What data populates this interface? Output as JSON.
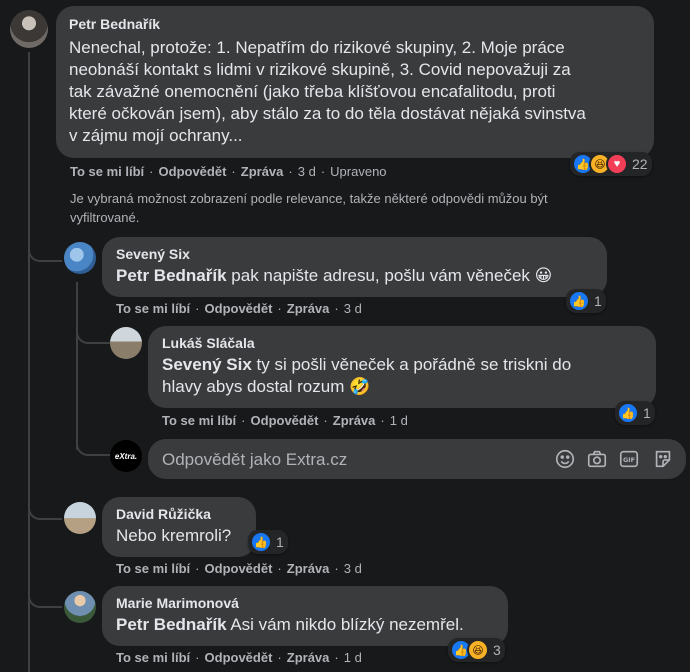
{
  "comments": {
    "main": {
      "author": "Petr Bednařík",
      "text_lines": [
        "Nenechal, protože: 1. Nepatřím do rizikové skupiny, 2. Moje práce",
        "neobnáší kontakt s lidmi v rizikové skupině, 3. Covid nepovažuji za",
        "tak závažné onemocnění (jako třeba klíšťovou encafalitodu, proti",
        "které očkován jsem), aby stálo za to do těla dostávat nějaká svinstva",
        "v zájmu mojí ochrany..."
      ],
      "like": "To se mi líbí",
      "reply": "Odpovědět",
      "message": "Zpráva",
      "time": "3 d",
      "edited": "Upraveno",
      "reaction_count": "22"
    },
    "relevance_notice_lines": [
      "Je vybraná možnost zobrazení podle relevance, takže některé odpovědi můžou být",
      "vyfiltrované."
    ],
    "reply1": {
      "author": "Sevený Six",
      "mention": "Petr Bednařík",
      "text": "pak napište adresu, pošlu vám věneček",
      "emoji": "😀",
      "like": "To se mi líbí",
      "reply": "Odpovědět",
      "message": "Zpráva",
      "time": "3 d",
      "reaction_count": "1"
    },
    "reply2": {
      "author": "Lukáš Sláčala",
      "mention": "Sevený Six",
      "text_line1": "ty si pošli věneček a pořádně se triskni do",
      "text_line2": "hlavy abys dostal rozum",
      "emoji": "🤣",
      "like": "To se mi líbí",
      "reply": "Odpovědět",
      "message": "Zpráva",
      "time": "1 d",
      "reaction_count": "1"
    },
    "reply_box": {
      "avatar_label": "eXtra.",
      "placeholder": "Odpovědět jako Extra.cz"
    },
    "comment2": {
      "author": "David Růžička",
      "text": "Nebo kremroli?",
      "like": "To se mi líbí",
      "reply": "Odpovědět",
      "message": "Zpráva",
      "time": "3 d",
      "reaction_count": "1"
    },
    "comment3": {
      "author": "Marie Marimonová",
      "mention": "Petr Bednařík",
      "text": "Asi vám nikdo blízký nezemřel.",
      "like": "To se mi líbí",
      "reply": "Odpovědět",
      "message": "Zpráva",
      "time": "1 d",
      "reaction_count": "3"
    }
  },
  "colors": {
    "background": "#18191a",
    "bubble": "#3a3b3c",
    "text": "#e4e6eb",
    "secondary": "#b0b3b8",
    "like_blue": "#1877f2"
  }
}
